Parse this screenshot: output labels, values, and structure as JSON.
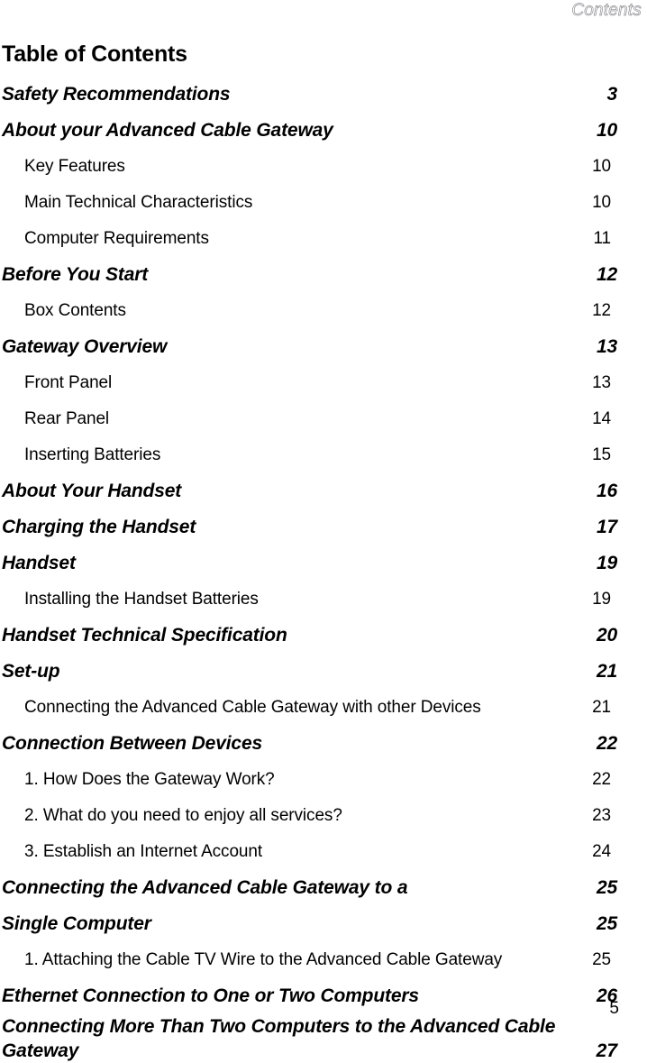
{
  "header": {
    "running_head": "Contents"
  },
  "footer": {
    "page_number": "5"
  },
  "document": {
    "title": "Table of Contents"
  },
  "entries": [
    {
      "level": 1,
      "label": "Safety Recommendations",
      "page": "3"
    },
    {
      "level": 1,
      "label": "About your Advanced Cable Gateway",
      "page": "10"
    },
    {
      "level": 2,
      "label": "Key Features",
      "page": "10"
    },
    {
      "level": 2,
      "label": "Main Technical Characteristics",
      "page": "10"
    },
    {
      "level": 2,
      "label": "Computer Requirements",
      "page": "11"
    },
    {
      "level": 1,
      "label": "Before You Start",
      "page": "12"
    },
    {
      "level": 2,
      "label": "Box Contents",
      "page": "12"
    },
    {
      "level": 1,
      "label": "Gateway Overview",
      "page": "13"
    },
    {
      "level": 2,
      "label": "Front Panel",
      "page": "13"
    },
    {
      "level": 2,
      "label": "Rear Panel",
      "page": "14"
    },
    {
      "level": 2,
      "label": "Inserting Batteries",
      "page": "15"
    },
    {
      "level": 1,
      "label": "About Your Handset",
      "page": "16"
    },
    {
      "level": 1,
      "label": "Charging the Handset",
      "page": "17"
    },
    {
      "level": 1,
      "label": "Handset",
      "page": "19"
    },
    {
      "level": 2,
      "label": "Installing the Handset Batteries",
      "page": "19"
    },
    {
      "level": 1,
      "label": "Handset Technical Specification",
      "page": "20"
    },
    {
      "level": 1,
      "label": "Set-up",
      "page": "21"
    },
    {
      "level": 2,
      "label": "Connecting the Advanced Cable Gateway with other Devices",
      "page": "21"
    },
    {
      "level": 1,
      "label": "Connection Between Devices",
      "page": "22"
    },
    {
      "level": 2,
      "label": "1. How Does the Gateway Work?",
      "page": "22"
    },
    {
      "level": 2,
      "label": "2. What do you need to enjoy all services?",
      "page": "23"
    },
    {
      "level": 2,
      "label": "3. Establish an Internet Account",
      "page": "24"
    },
    {
      "level": 1,
      "label": "Connecting the Advanced Cable Gateway to a",
      "page": "25"
    },
    {
      "level": 1,
      "label": "Single Computer",
      "page": "25"
    },
    {
      "level": 2,
      "label": "1. Attaching the Cable TV Wire to the Advanced Cable Gateway",
      "page": "25"
    },
    {
      "level": 1,
      "label": "Ethernet Connection to One or Two Computers",
      "page": "26"
    },
    {
      "level": 1,
      "label": "Connecting More Than Two Computers to the Advanced Cable Gateway",
      "page": "27",
      "wrap": true
    }
  ]
}
